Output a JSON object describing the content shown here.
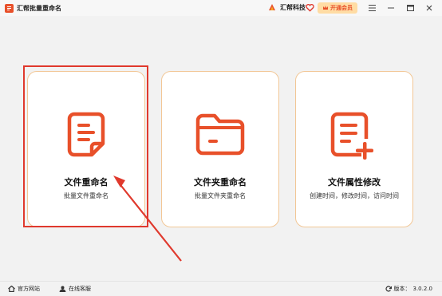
{
  "window": {
    "title": "汇帮批量重命名"
  },
  "header": {
    "brand_name": "汇帮科技",
    "vip_label": "开通会员"
  },
  "cards": [
    {
      "title": "文件重命名",
      "subtitle": "批量文件重命名"
    },
    {
      "title": "文件夹重命名",
      "subtitle": "批量文件夹重命名"
    },
    {
      "title": "文件属性修改",
      "subtitle": "创建时间，修改时间，访问时间"
    }
  ],
  "statusbar": {
    "website": "官方网站",
    "support": "在线客服",
    "version_label": "版本：",
    "version": "3.0.2.0"
  },
  "colors": {
    "accent": "#e8502a",
    "card_border": "#f2c796",
    "highlight": "#e0392d",
    "vip_bg": "#ffdca4"
  }
}
